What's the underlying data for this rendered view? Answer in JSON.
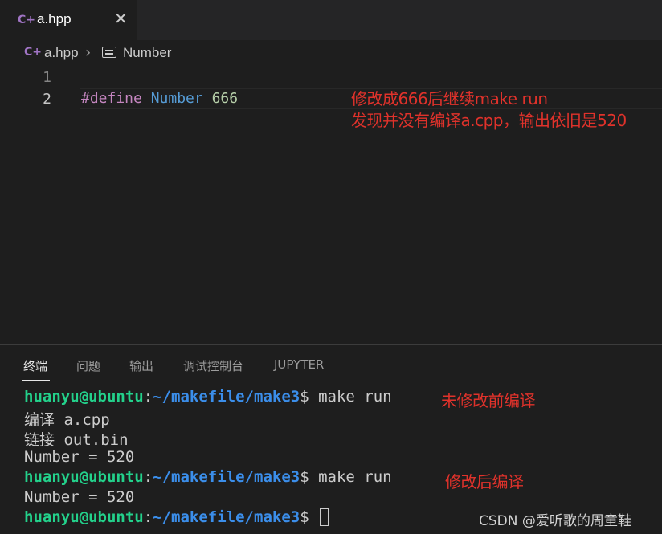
{
  "tab": {
    "label": "a.hpp",
    "icon": "c-plus-plus-icon",
    "close": "✕"
  },
  "breadcrumb": {
    "file": "a.hpp",
    "separator": "›",
    "symbol": "Number",
    "symbol_icon": "symbol-constant-icon"
  },
  "editor": {
    "line_numbers": [
      "1",
      "2"
    ],
    "code": {
      "keyword": "#define",
      "name": "Number",
      "value": "666"
    }
  },
  "annotations": {
    "editor_line1": "修改成666后继续make run",
    "editor_line2": "发现并没有编译a.cpp，输出依旧是520",
    "terminal_before": "未修改前编译",
    "terminal_after": "修改后编译"
  },
  "panel": {
    "tabs": [
      "终端",
      "问题",
      "输出",
      "调试控制台",
      "JUPYTER"
    ]
  },
  "terminal": {
    "prompt_user": "huanyu@ubuntu",
    "prompt_colon": ":",
    "prompt_path": "~/makefile/make3",
    "prompt_symbol": "$ ",
    "command": "make run",
    "lines": [
      "编译 a.cpp",
      "链接 out.bin",
      "Number = 520",
      "Number = 520"
    ]
  },
  "watermark": "CSDN @爱听歌的周童鞋",
  "colors": {
    "accent_red": "#e0322b",
    "prompt_green": "#23d18b",
    "prompt_blue": "#3b8eea"
  }
}
